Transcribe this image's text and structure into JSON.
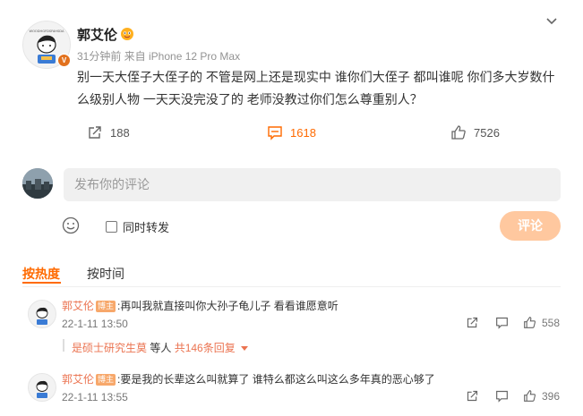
{
  "post": {
    "author": "郭艾伦",
    "avatar_caption": "WOODHGFDSFAHSDA",
    "meta": "31分钟前 来自 iPhone 12 Pro Max",
    "line1": "别一天大侄子大侄子的 不管是网上还是现实中 谁你们大侄子 都叫谁呢 你们多大岁数什",
    "line2": "么级别人物 一天天没完没了的 老师没教过你们怎么尊重别人？",
    "repost_count": "188",
    "comment_count": "1618",
    "like_count": "7526"
  },
  "composer": {
    "placeholder": "发布你的评论",
    "repost_label": "同时转发",
    "submit_label": "评论"
  },
  "sort": {
    "hot": "按热度",
    "time": "按时间"
  },
  "comments": [
    {
      "author": "郭艾伦",
      "tag": "博主",
      "text": ":再叫我就直接叫你大孙子龟儿子 看看谁愿意听",
      "time": "22-1-11 13:50",
      "likes": "558",
      "reply_user": "是硕士研究生莫",
      "reply_mid": " 等人 ",
      "reply_count": "共146条回复"
    },
    {
      "author": "郭艾伦",
      "tag": "博主",
      "text": ":要是我的长辈这么叫就算了 谁特么都这么叫这么多年真的恶心够了",
      "time": "22-1-11 13:55",
      "likes": "396"
    }
  ],
  "colors": {
    "accent": "#ff6a00",
    "name": "#eb7350",
    "submit": "#ffc89f",
    "verified": "#e2711d"
  }
}
